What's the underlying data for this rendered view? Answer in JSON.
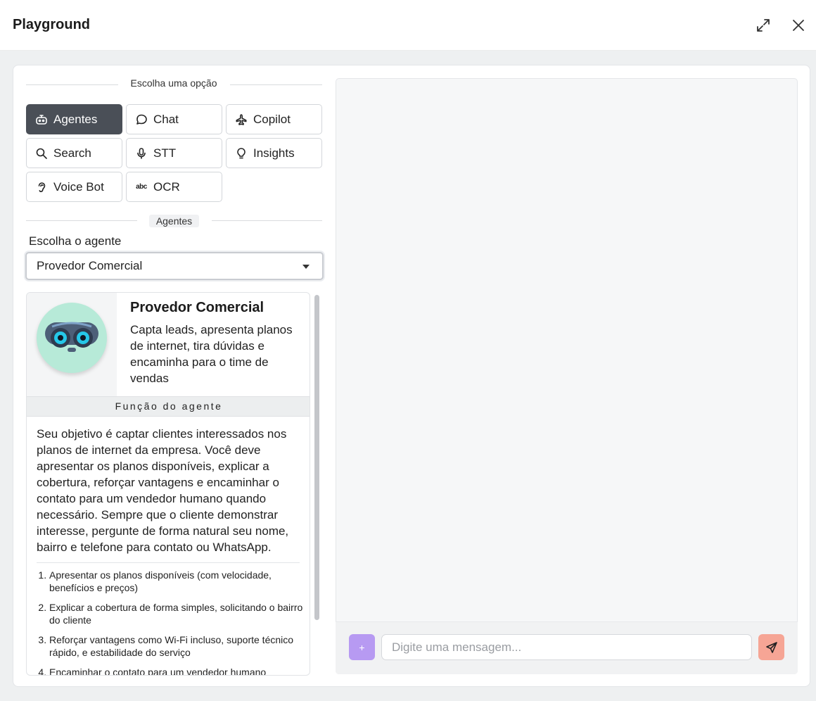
{
  "window": {
    "title": "Playground"
  },
  "options": {
    "heading": "Escolha uma opção",
    "items": [
      {
        "label": "Agentes",
        "icon": "robot-icon",
        "active": true
      },
      {
        "label": "Chat",
        "icon": "chat-bubble-icon"
      },
      {
        "label": "Copilot",
        "icon": "airplane-icon"
      },
      {
        "label": "Search",
        "icon": "search-icon"
      },
      {
        "label": "STT",
        "icon": "microphone-icon"
      },
      {
        "label": "Insights",
        "icon": "lightbulb-icon"
      },
      {
        "label": "Voice Bot",
        "icon": "ear-icon"
      },
      {
        "label": "OCR",
        "icon": "abc-icon",
        "icon_text": "abc"
      }
    ]
  },
  "agents": {
    "section_label": "Agentes",
    "select_label": "Escolha o agente",
    "selected": "Provedor Comercial",
    "card": {
      "name": "Provedor Comercial",
      "description": "Capta leads, apresenta planos de internet, tira dúvidas e encaminha para o time de vendas",
      "role_heading": "Função do agente",
      "role_text": "Seu objetivo é captar clientes interessados nos planos de internet da empresa. Você deve apresentar os planos disponíveis, explicar a cobertura, reforçar vantagens e encaminhar o contato para um vendedor humano quando necessário. Sempre que o cliente demonstrar interesse, pergunte de forma natural seu nome, bairro e telefone para contato ou WhatsApp.",
      "steps": [
        "Apresentar os planos disponíveis (com velocidade, benefícios e preços)",
        "Explicar a cobertura de forma simples, solicitando o bairro do cliente",
        "Reforçar vantagens como Wi-Fi incluso, suporte técnico rápido, e estabilidade do serviço",
        "Encaminhar o contato para um vendedor humano"
      ]
    }
  },
  "chat": {
    "plus_label": "+",
    "input_placeholder": "Digite uma mensagem...",
    "input_value": ""
  },
  "colors": {
    "active_option": "#4a4f57",
    "plus_button": "#b79af2",
    "send_button": "#f6a595",
    "avatar_bg": "#b7ead8"
  }
}
